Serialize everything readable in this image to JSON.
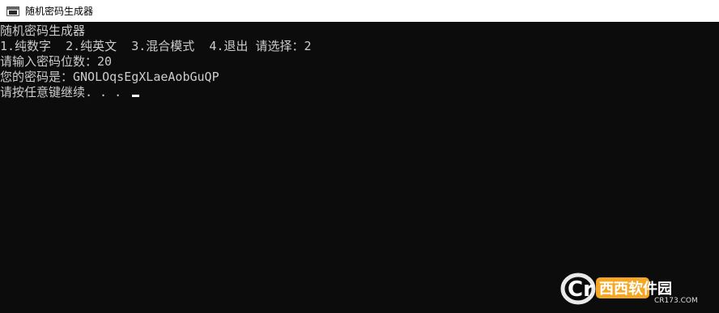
{
  "window": {
    "title": "随机密码生成器"
  },
  "console": {
    "lines": [
      "随机密码生成器",
      "1.纯数字  2.纯英文  3.混合模式  4.退出 请选择：2",
      "请输入密码位数：20",
      "您的密码是：GNOLOqsEgXLaeAobGuQP",
      "请按任意键继续. . . "
    ]
  },
  "watermark": {
    "brand": "西西软件园",
    "site": "CR173.COM",
    "logo_letter": "Cr"
  },
  "colors": {
    "console_bg": "#0c0c0c",
    "console_text": "#cccccc",
    "titlebar_bg": "#ffffff",
    "watermark_accent": "#f5a623"
  },
  "icons": {
    "app": "console-app-icon",
    "cursor": "text-cursor"
  }
}
